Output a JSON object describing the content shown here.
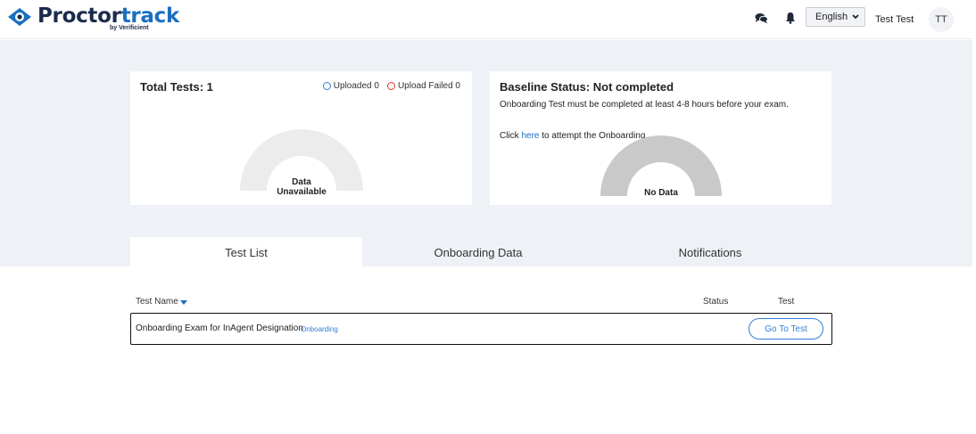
{
  "header": {
    "logo_dark": "Proctor",
    "logo_blue": "track",
    "logo_sub": "by Verificient",
    "chat_icon": "chat-bubbles-icon",
    "bell_icon": "bell-icon",
    "language": "English",
    "user_name": "Test Test",
    "avatar_initials": "TT"
  },
  "total_card": {
    "title": "Total Tests: 1",
    "uploaded_label": "Uploaded 0",
    "upload_failed_label": "Upload Failed 0",
    "gauge_label_line1": "Data",
    "gauge_label_line2": "Unavailable"
  },
  "baseline_card": {
    "title": "Baseline Status: Not completed",
    "message": "Onboarding Test must be completed at least 4-8 hours before your exam.",
    "click_prefix": "Click ",
    "link_text": "here",
    "click_suffix": " to attempt the Onboarding.",
    "gauge_label": "No Data"
  },
  "tabs": [
    "Test List",
    "Onboarding Data",
    "Notifications"
  ],
  "table": {
    "columns": {
      "name": "Test Name",
      "status": "Status",
      "test": "Test"
    },
    "rows": [
      {
        "name": "Onboarding Exam for InAgent Designation",
        "badge": "Onboarding",
        "status": "",
        "action": "Go To Test"
      }
    ]
  },
  "colors": {
    "brand_dark": "#1b2b4b",
    "brand_blue": "#1a6fc0",
    "accent": "#2f7fd8",
    "failed": "#e0352b",
    "band_bg": "#eef1f5"
  }
}
